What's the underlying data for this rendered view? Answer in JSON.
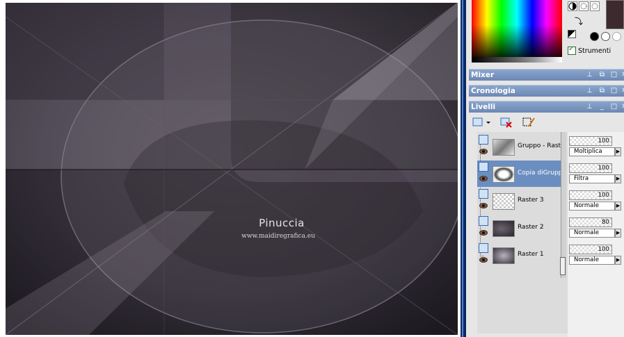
{
  "canvas": {
    "watermark_title": "Pinuccia",
    "watermark_url": "www.maidiregrafica.eu"
  },
  "tools": {
    "strumenti_label": "Strumenti",
    "strumenti_checked": true,
    "foreground_color": "#3d2a2e"
  },
  "palettes": {
    "mixer": "Mixer",
    "cronologia": "Cronologia",
    "livelli": "Livelli"
  },
  "layers": [
    {
      "name": "Gruppo - Raster",
      "opacity": "100",
      "blend": "Moltiplica",
      "selected": false
    },
    {
      "name": "Copia diGruppo",
      "opacity": "100",
      "blend": "Filtra",
      "selected": true
    },
    {
      "name": "Raster 3",
      "opacity": "100",
      "blend": "Normale",
      "selected": false
    },
    {
      "name": "Raster 2",
      "opacity": "80",
      "blend": "Normale",
      "selected": false
    },
    {
      "name": "Raster 1",
      "opacity": "100",
      "blend": "Normale",
      "selected": false
    }
  ],
  "colors": {
    "title_bar": "#6b87b3",
    "selected_row": "#6b8ec0",
    "divider": "#0a2a66"
  }
}
